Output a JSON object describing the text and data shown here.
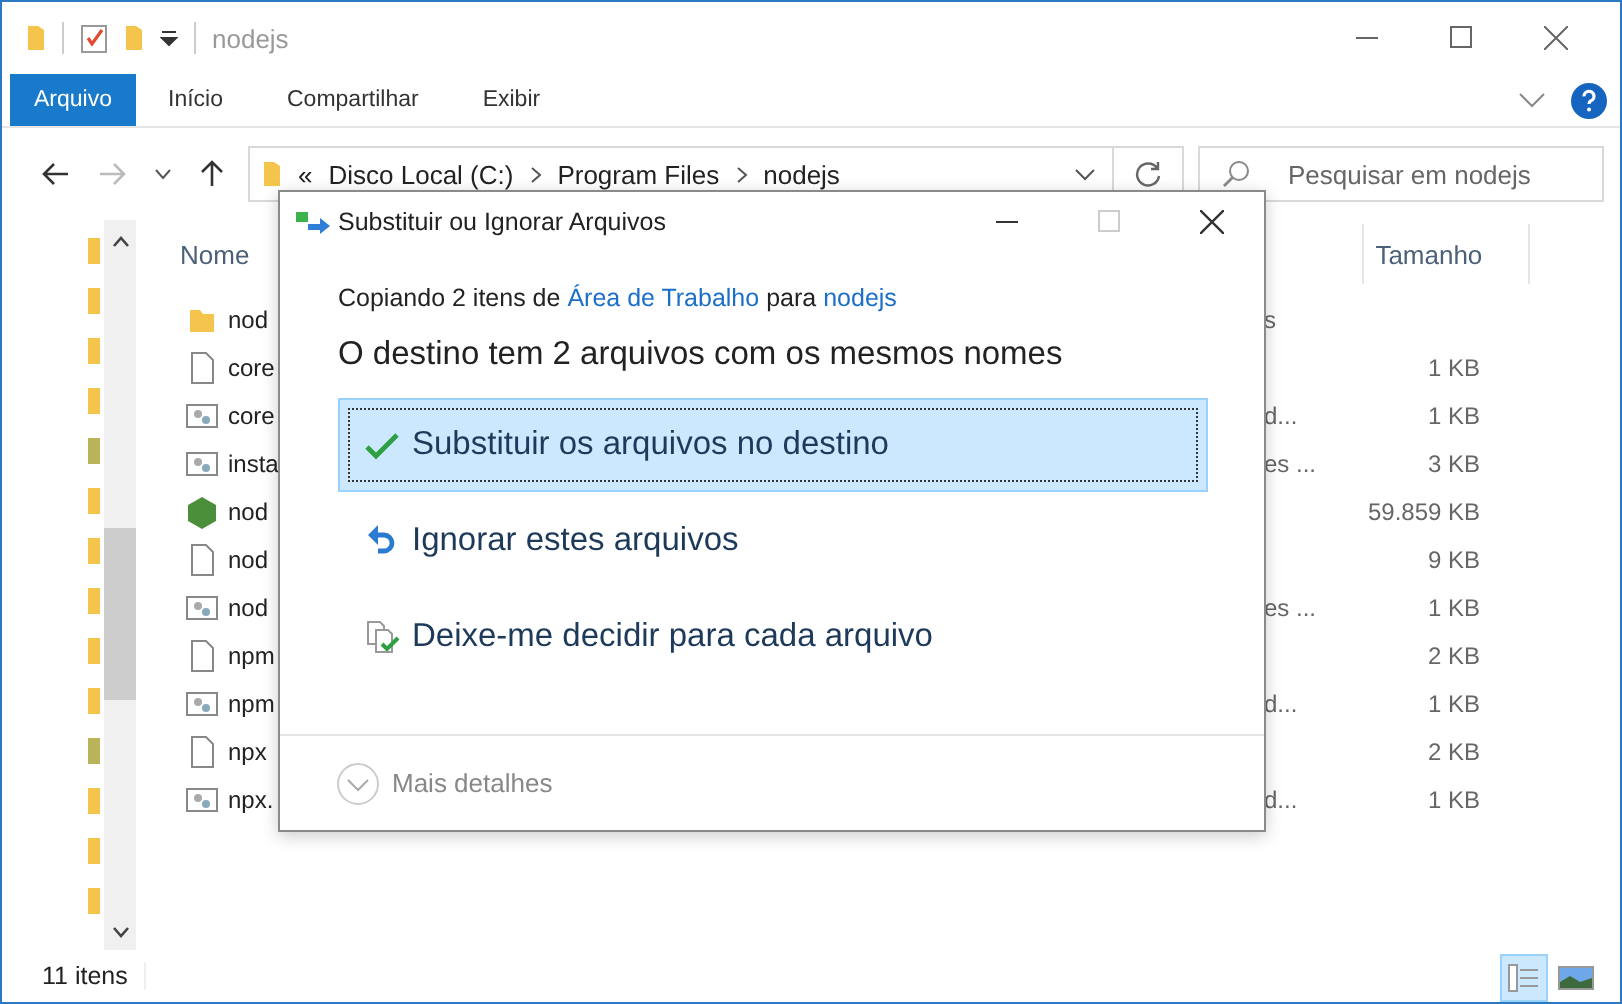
{
  "window": {
    "title": "nodejs"
  },
  "ribbon_tabs": [
    {
      "label": "Arquivo",
      "selected": true
    },
    {
      "label": "Início",
      "selected": false
    },
    {
      "label": "Compartilhar",
      "selected": false
    },
    {
      "label": "Exibir",
      "selected": false
    }
  ],
  "address": {
    "overflow": "«",
    "path": [
      "Disco Local (C:)",
      "Program Files",
      "nodejs"
    ]
  },
  "search": {
    "placeholder": "Pesquisar em nodejs"
  },
  "columns": [
    "Nome",
    "Tamanho"
  ],
  "files": [
    {
      "kind": "folder",
      "name": "nod",
      "type": "s"
    },
    {
      "kind": "file",
      "name": "core",
      "size": "1 KB"
    },
    {
      "kind": "script",
      "name": "core",
      "type": "d...",
      "size": "1 KB"
    },
    {
      "kind": "script",
      "name": "insta",
      "type": "es ...",
      "size": "3 KB"
    },
    {
      "kind": "node",
      "name": "nod",
      "size": "59.859 KB"
    },
    {
      "kind": "file",
      "name": "nod",
      "size": "9 KB"
    },
    {
      "kind": "script",
      "name": "nod",
      "type": "es ...",
      "size": "1 KB"
    },
    {
      "kind": "file",
      "name": "npm",
      "size": "2 KB"
    },
    {
      "kind": "script",
      "name": "npm",
      "type": "d...",
      "size": "1 KB"
    },
    {
      "kind": "file",
      "name": "npx",
      "size": "2 KB"
    },
    {
      "kind": "script",
      "name": "npx.",
      "type": "d...",
      "size": "1 KB"
    }
  ],
  "status_bar": {
    "count": "11 itens"
  },
  "view_buttons": [
    {
      "kind": "details",
      "selected": true
    },
    {
      "kind": "tiles",
      "selected": false
    }
  ],
  "dialog": {
    "title": "Substituir ou Ignorar Arquivos",
    "summary": [
      {
        "text": "Copiando 2 itens de",
        "link": false
      },
      {
        "text": "Área de Trabalho",
        "link": true
      },
      {
        "text": "para",
        "link": false
      },
      {
        "text": "nodejs",
        "link": true
      }
    ],
    "heading": "O destino tem 2 arquivos com os mesmos nomes",
    "options": [
      {
        "kind": "replace",
        "label": "Substituir os arquivos no destino",
        "selected": true
      },
      {
        "kind": "skip",
        "label": "Ignorar estes arquivos",
        "selected": false
      },
      {
        "kind": "decide",
        "label": "Deixe-me decidir para cada arquivo",
        "selected": false
      }
    ],
    "details_toggle": {
      "label": "Mais detalhes",
      "expanded": false
    }
  }
}
